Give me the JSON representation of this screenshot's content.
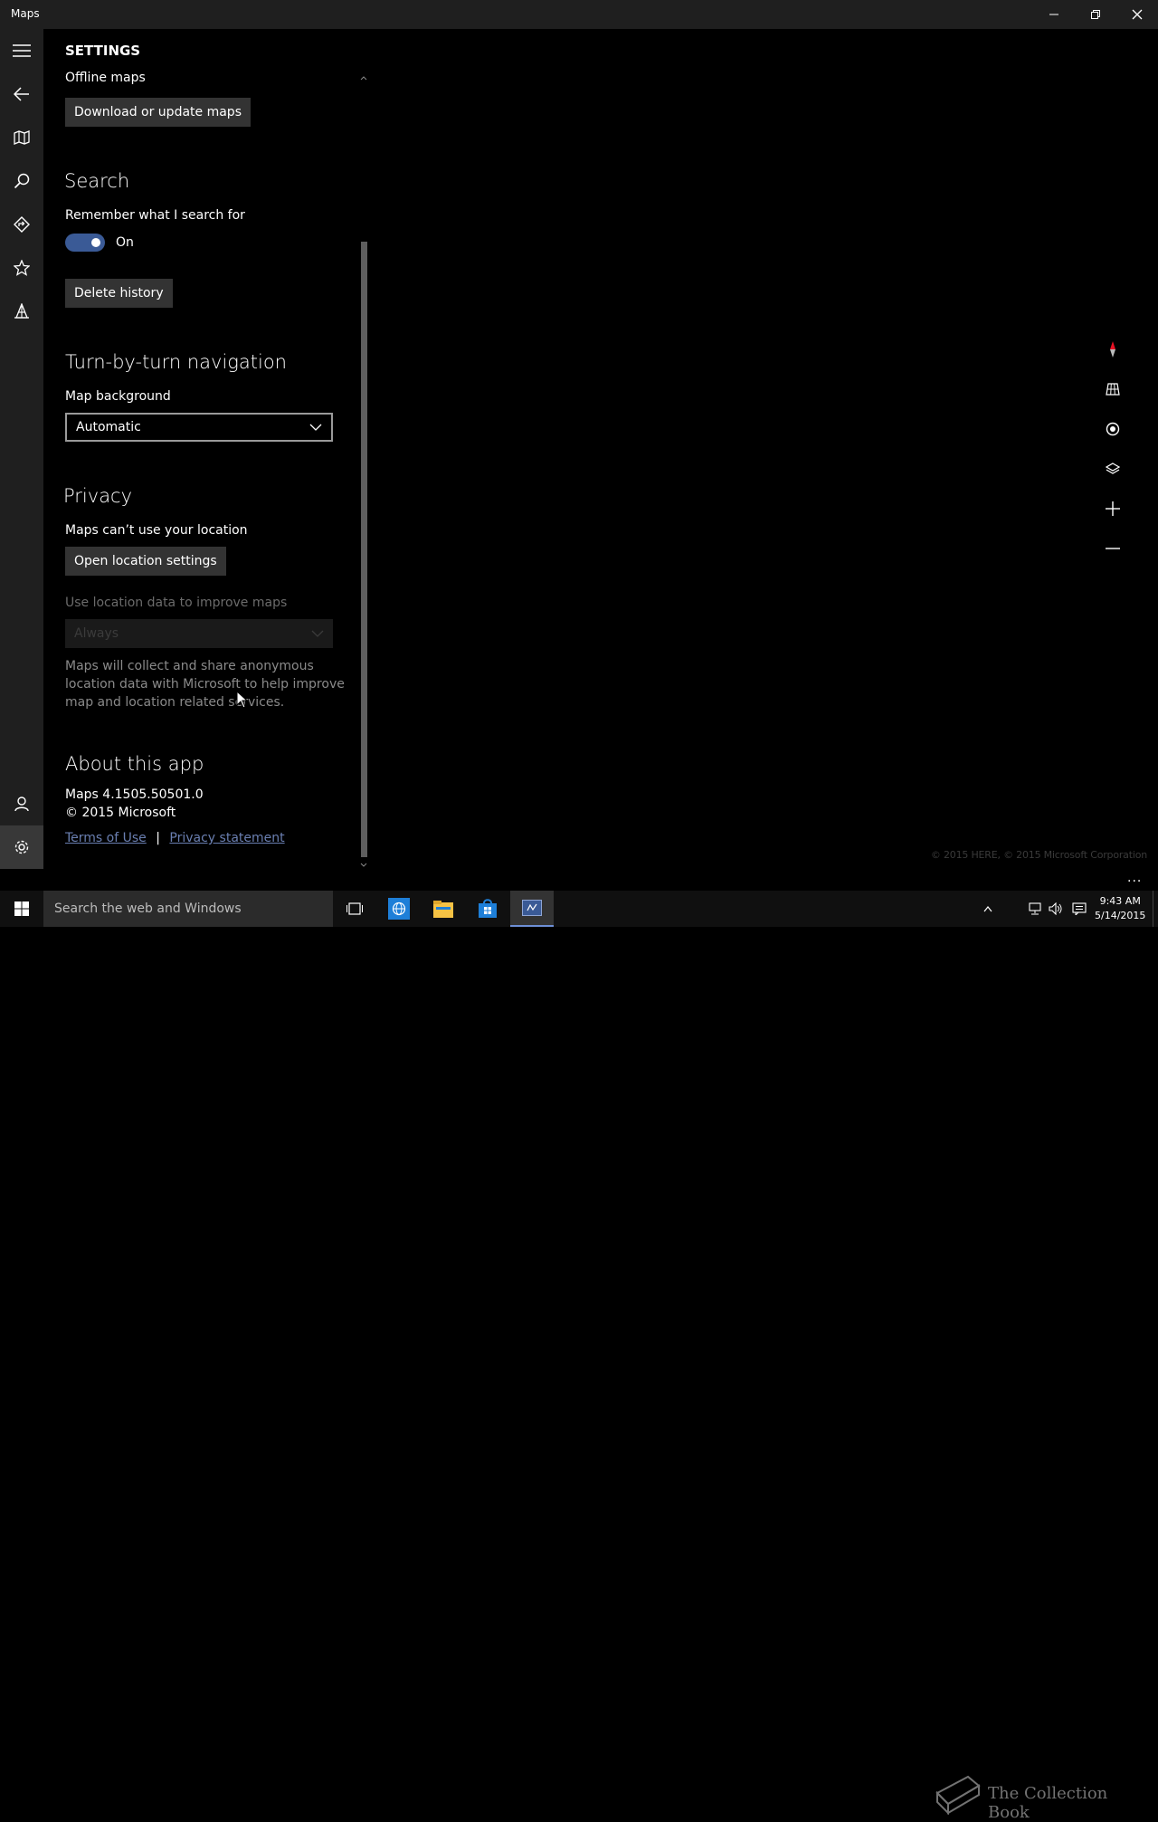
{
  "window": {
    "title": "Maps"
  },
  "nav": {
    "items": [
      {
        "icon": "hamburger-icon"
      },
      {
        "icon": "back-arrow-icon"
      },
      {
        "icon": "map-icon"
      },
      {
        "icon": "search-icon"
      },
      {
        "icon": "directions-icon"
      },
      {
        "icon": "star-icon"
      },
      {
        "icon": "3d-cities-icon"
      },
      {
        "icon": "account-icon"
      },
      {
        "icon": "gear-icon"
      }
    ]
  },
  "settings": {
    "title": "SETTINGS",
    "offline_label": "Offline maps",
    "offline_button": "Download or update maps",
    "search_heading": "Search",
    "remember_label": "Remember what I search for",
    "remember_toggle_state": "On",
    "delete_history_button": "Delete history",
    "nav_heading": "Turn-by-turn navigation",
    "map_background_label": "Map background",
    "map_background_value": "Automatic",
    "privacy_heading": "Privacy",
    "location_status": "Maps can’t use your location",
    "open_location_button": "Open location settings",
    "use_location_label": "Use location data to improve maps",
    "use_location_value": "Always",
    "use_location_desc_1": "Maps will collect and share anonymous",
    "use_location_desc_2": "location data with Microsoft to help improve",
    "use_location_desc_3": "map and location related services.",
    "about_heading": "About this app",
    "version": "Maps 4.1505.50501.0",
    "copyright": "© 2015 Microsoft",
    "terms_link": "Terms of Use",
    "link_separator": "|",
    "privacy_link": "Privacy statement"
  },
  "map": {
    "copyright": "© 2015 HERE, © 2015 Microsoft Corporation",
    "more_label": "...",
    "compass_color": "#e81123"
  },
  "taskbar": {
    "search_placeholder": "Search the web and Windows",
    "time": "9:43 AM",
    "date": "5/14/2015",
    "accent": "#6d8fd6"
  },
  "watermark": {
    "text": "The Collection Book"
  }
}
